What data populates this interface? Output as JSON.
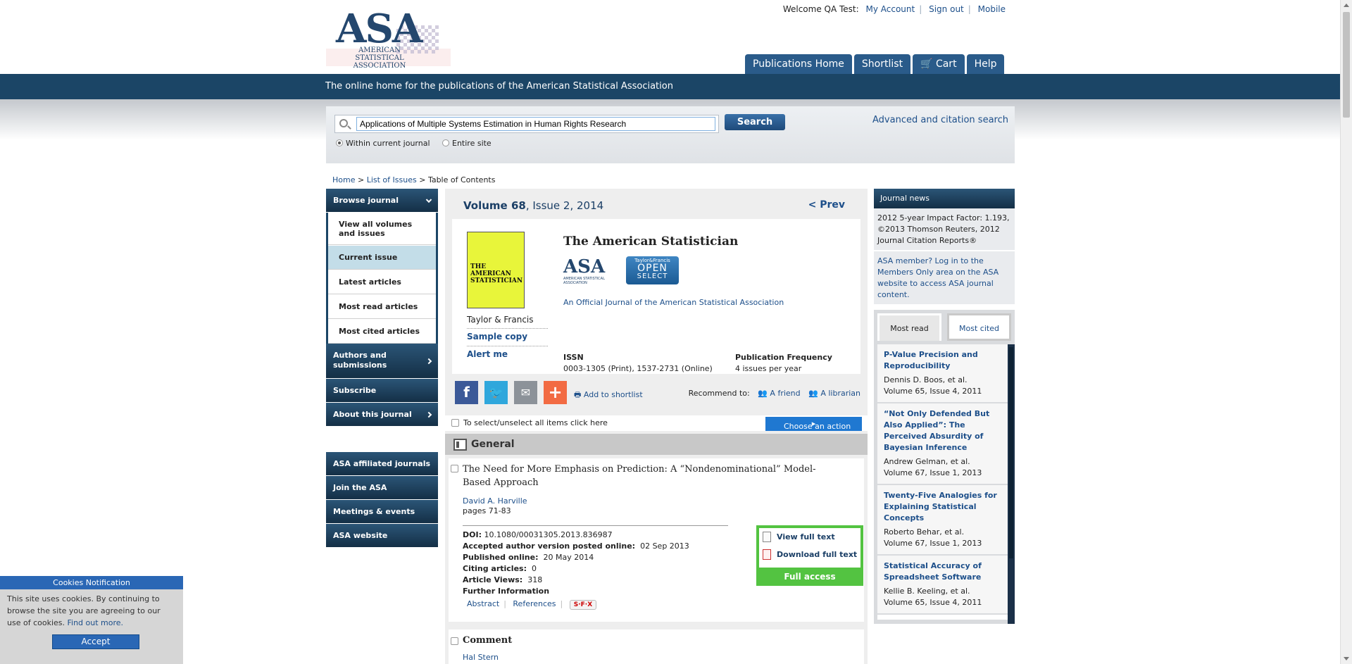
{
  "header": {
    "logo_text": "ASA",
    "logo_subtext": "AMERICAN STATISTICAL ASSOCIATION",
    "welcome": "Welcome QA Test:",
    "my_account": "My Account",
    "sign_out": "Sign out",
    "mobile": "Mobile",
    "tabs": [
      "Publications Home",
      "Shortlist",
      "Cart",
      "Help"
    ],
    "tagline": "The online home for the publications of the American Statistical Association"
  },
  "search": {
    "value": "Applications of Multiple Systems Estimation in Human Rights Research",
    "button": "Search",
    "scope_current": "Within current journal",
    "scope_site": "Entire site",
    "advanced": "Advanced and citation search"
  },
  "breadcrumb": {
    "home": "Home",
    "issues": "List of Issues",
    "current": "Table of Contents"
  },
  "leftnav": {
    "browse": "Browse journal",
    "items": [
      "View all volumes and issues",
      "Current issue",
      "Latest articles",
      "Most read articles",
      "Most cited articles"
    ],
    "authors": "Authors and submissions",
    "subscribe": "Subscribe",
    "about": "About this journal",
    "links": [
      "ASA affiliated journals",
      "Join the ASA",
      "Meetings & events",
      "ASA website"
    ]
  },
  "issue": {
    "volume": "Volume 68",
    "issue": ", Issue 2, 2014",
    "prev": "< Prev",
    "cover_title": "THE AMERICAN STATISTICIAN",
    "publisher": "Taylor & Francis",
    "sample_copy": "Sample copy",
    "alert_me": "Alert me",
    "journal_title": "The American Statistician",
    "official": "An Official Journal of the American Statistical Association",
    "asa_badge": "ASA",
    "asa_badge_sub": "AMERICAN STATISTICAL ASSOCIATION",
    "open_select_tf": "Taylor&Francis",
    "open_select_1": "OPEN",
    "open_select_2": "SELECT",
    "issn_label": "ISSN",
    "issn_value": "0003-1305 (Print), 1537-2731 (Online)",
    "freq_label": "Publication Frequency",
    "freq_value": "4 issues per year"
  },
  "share": {
    "add_shortlist": "Add to shortlist",
    "recommend": "Recommend to:",
    "friend": "A friend",
    "librarian": "A librarian"
  },
  "selectbar": {
    "text": "To select/unselect all items click here",
    "choose": "Choose an action"
  },
  "section_general": "General",
  "article": {
    "title": "The Need for More Emphasis on Prediction: A “Nondenominational” Model-Based Approach",
    "author": "David A. Harville",
    "pages": "pages 71-83",
    "doi_label": "DOI:",
    "doi": "10.1080/00031305.2013.836987",
    "accepted_label": "Accepted author version posted online:",
    "accepted": "02 Sep 2013",
    "published_label": "Published online:",
    "published": "20 May 2014",
    "citing_label": "Citing articles:",
    "citing": "0",
    "views_label": "Article Views:",
    "views": "318",
    "further": "Further Information",
    "abstract": "Abstract",
    "references": "References",
    "sfx": "S·F·X",
    "view_full": "View full text",
    "download_full": "Download full text",
    "full_access": "Full access"
  },
  "comment": {
    "title": "Comment",
    "author": "Hal Stern"
  },
  "journal_news": {
    "head": "Journal news",
    "items": [
      "2012 5-year Impact Factor: 1.193, ©2013 Thomson Reuters, 2012 Journal Citation Reports®",
      "ASA member? Log in to the Members Only area on the ASA website to access ASA journal content."
    ]
  },
  "most_read": {
    "tab_read": "Most read",
    "tab_cited": "Most cited",
    "items": [
      {
        "title": "P-Value Precision and Reproducibility",
        "authors": "Dennis D. Boos, et al.",
        "issue": "Volume 65, Issue 4, 2011"
      },
      {
        "title": "“Not Only Defended But Also Applied”: The Perceived Absurdity of Bayesian Inference",
        "authors": "Andrew Gelman, et al.",
        "issue": "Volume 67, Issue 1, 2013"
      },
      {
        "title": "Twenty-Five Analogies for Explaining Statistical Concepts",
        "authors": "Roberto Behar, et al.",
        "issue": "Volume 67, Issue 1, 2013"
      },
      {
        "title": "Statistical Accuracy of Spreadsheet Software",
        "authors": "Kellie B. Keeling, et al.",
        "issue": "Volume 65, Issue 4, 2011"
      }
    ]
  },
  "cookie": {
    "head": "Cookies Notification",
    "text": "This site uses cookies. By continuing to browse the site you are agreeing to our use of cookies.",
    "link": "Find out more.",
    "accept": "Accept"
  },
  "colors": {
    "brand_navy": "#1b4566",
    "link": "#1d4f8a",
    "full_access_green": "#53c341",
    "action_blue": "#1f78d1"
  }
}
